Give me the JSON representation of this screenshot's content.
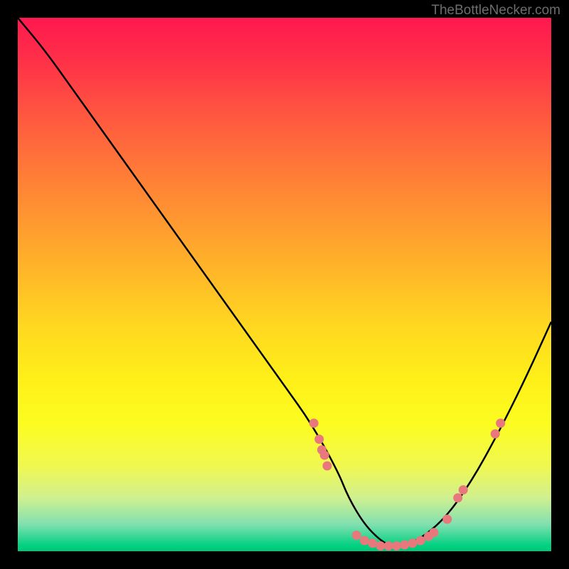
{
  "watermark": "TheBottleNecker.com",
  "chart_data": {
    "type": "line",
    "title": "",
    "xlabel": "",
    "ylabel": "",
    "xlim": [
      0,
      100
    ],
    "ylim": [
      0,
      100
    ],
    "curve": {
      "x": [
        0,
        5,
        10,
        15,
        20,
        25,
        30,
        35,
        40,
        45,
        50,
        55,
        60,
        62,
        65,
        68,
        70,
        72,
        75,
        80,
        85,
        90,
        95,
        100
      ],
      "y": [
        100,
        94,
        87,
        80,
        73,
        66,
        59,
        52,
        45,
        38,
        31,
        24,
        15,
        10,
        5,
        2,
        1,
        1,
        2,
        6,
        13,
        22,
        32,
        43
      ]
    },
    "scatter_points": [
      {
        "x": 55.5,
        "y": 24
      },
      {
        "x": 56.5,
        "y": 21
      },
      {
        "x": 57.0,
        "y": 19
      },
      {
        "x": 57.5,
        "y": 18
      },
      {
        "x": 58.0,
        "y": 16
      },
      {
        "x": 63.5,
        "y": 3
      },
      {
        "x": 65.0,
        "y": 2
      },
      {
        "x": 66.5,
        "y": 1.5
      },
      {
        "x": 68.0,
        "y": 1
      },
      {
        "x": 69.5,
        "y": 1
      },
      {
        "x": 71.0,
        "y": 1
      },
      {
        "x": 72.5,
        "y": 1.2
      },
      {
        "x": 74.0,
        "y": 1.5
      },
      {
        "x": 75.5,
        "y": 2
      },
      {
        "x": 77.0,
        "y": 2.8
      },
      {
        "x": 78.0,
        "y": 3.5
      },
      {
        "x": 80.5,
        "y": 6
      },
      {
        "x": 82.5,
        "y": 10
      },
      {
        "x": 83.5,
        "y": 11.5
      },
      {
        "x": 89.5,
        "y": 22
      },
      {
        "x": 90.5,
        "y": 24
      }
    ],
    "scatter_color": "#e8787b",
    "curve_color": "#000000"
  }
}
